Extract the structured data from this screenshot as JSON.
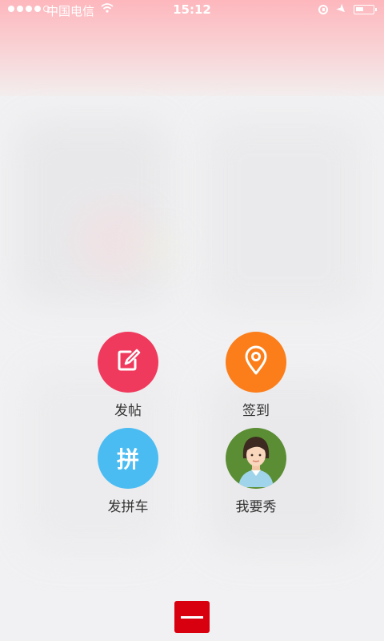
{
  "status_bar": {
    "carrier": "中国电信",
    "time": "15:12",
    "signal_dots": 5
  },
  "menu": {
    "post": {
      "label": "发帖",
      "icon": "edit-icon",
      "color": "#f03a5d"
    },
    "checkin": {
      "label": "签到",
      "icon": "location-pin-icon",
      "color": "#fb7e1a"
    },
    "carpool": {
      "label": "发拼车",
      "glyph": "拼",
      "icon": "carpool-icon",
      "color": "#4bbcf2"
    },
    "show": {
      "label": "我要秀",
      "icon": "avatar-icon",
      "color": "#5b8e34"
    }
  },
  "close": {
    "icon": "minus-icon",
    "color": "#d8000f"
  }
}
